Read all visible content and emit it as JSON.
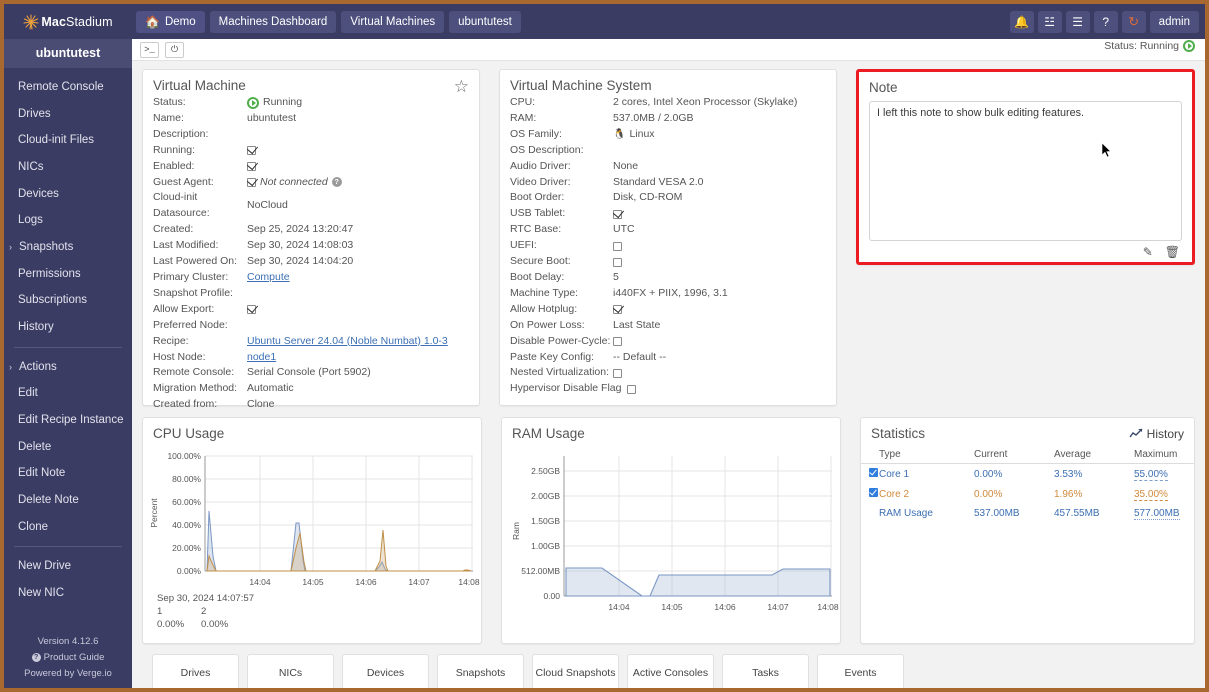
{
  "brand": {
    "name_bold": "Mac",
    "name_rest": "Stadium",
    "logo_icon": "sunburst-logo"
  },
  "topnav": {
    "breadcrumbs": [
      {
        "label": "Demo",
        "icon": "home-icon"
      },
      {
        "label": "Machines Dashboard"
      },
      {
        "label": "Virtual Machines"
      },
      {
        "label": "ubuntutest"
      }
    ],
    "actions": [
      {
        "name": "notifications-icon",
        "glyph": "🔔"
      },
      {
        "name": "rss-icon",
        "glyph": "☳"
      },
      {
        "name": "tasks-icon",
        "glyph": "☰"
      },
      {
        "name": "help-icon",
        "glyph": "?"
      },
      {
        "name": "refresh-icon",
        "glyph": "↻"
      }
    ],
    "user_label": "admin"
  },
  "sidebar": {
    "title": "ubuntutest",
    "items": [
      {
        "label": "Remote Console"
      },
      {
        "label": "Drives"
      },
      {
        "label": "Cloud-init Files"
      },
      {
        "label": "NICs"
      },
      {
        "label": "Devices"
      },
      {
        "label": "Logs"
      },
      {
        "label": "Snapshots",
        "expandable": true
      },
      {
        "label": "Permissions"
      },
      {
        "label": "Subscriptions"
      },
      {
        "label": "History"
      },
      {
        "separator": true
      },
      {
        "label": "Actions",
        "expandable": true
      },
      {
        "label": "Edit"
      },
      {
        "label": "Edit Recipe Instance"
      },
      {
        "label": "Delete"
      },
      {
        "label": "Edit Note"
      },
      {
        "label": "Delete Note"
      },
      {
        "label": "Clone"
      },
      {
        "separator": true
      },
      {
        "label": "New Drive"
      },
      {
        "label": "New NIC"
      }
    ],
    "footer": {
      "version": "Version 4.12.6",
      "product_guide": "Product Guide",
      "powered_by": "Powered by Verge.io"
    }
  },
  "toolbar": {
    "console_icon": ">_",
    "power_icon": "⏻",
    "status_label": "Status: Running"
  },
  "vm_card": {
    "title": "Virtual Machine",
    "favorite_icon": "star-icon",
    "rows": [
      {
        "key": "Status:",
        "value": "Running",
        "type": "status"
      },
      {
        "key": "Name:",
        "value": "ubuntutest"
      },
      {
        "key": "Description:",
        "value": ""
      },
      {
        "key": "Running:",
        "value": "",
        "type": "check"
      },
      {
        "key": "Enabled:",
        "value": "",
        "type": "check"
      },
      {
        "key": "Guest Agent:",
        "value": "Not connected",
        "type": "check-note"
      },
      {
        "key": "Cloud-init Datasource:",
        "value": "NoCloud"
      },
      {
        "key": "Created:",
        "value": "Sep 25, 2024 13:20:47"
      },
      {
        "key": "Last Modified:",
        "value": "Sep 30, 2024 14:08:03"
      },
      {
        "key": "Last Powered On:",
        "value": "Sep 30, 2024 14:04:20"
      },
      {
        "key": "Primary Cluster:",
        "value": "Compute",
        "type": "link"
      },
      {
        "key": "Snapshot Profile:",
        "value": ""
      },
      {
        "key": "Allow Export:",
        "value": "",
        "type": "check"
      },
      {
        "key": "Preferred Node:",
        "value": ""
      },
      {
        "key": "Recipe:",
        "value": "Ubuntu Server 24.04 (Noble Numbat) 1.0-3",
        "type": "link"
      },
      {
        "key": "Host Node:",
        "value": "node1",
        "type": "link"
      },
      {
        "key": "Remote Console:",
        "value": "Serial Console (Port 5902)"
      },
      {
        "key": "Migration Method:",
        "value": "Automatic"
      },
      {
        "key": "Created from:",
        "value": "Clone"
      }
    ]
  },
  "vms_card": {
    "title": "Virtual Machine System",
    "rows": [
      {
        "key": "CPU:",
        "value": "2 cores, Intel Xeon Processor (Skylake)"
      },
      {
        "key": "RAM:",
        "value": "537.0MB / 2.0GB"
      },
      {
        "key": "OS Family:",
        "value": "Linux",
        "type": "os"
      },
      {
        "key": "OS Description:",
        "value": ""
      },
      {
        "key": "Audio Driver:",
        "value": "None"
      },
      {
        "key": "Video Driver:",
        "value": "Standard VESA 2.0"
      },
      {
        "key": "Boot Order:",
        "value": "Disk, CD-ROM"
      },
      {
        "key": "USB Tablet:",
        "value": "",
        "type": "check"
      },
      {
        "key": "RTC Base:",
        "value": "UTC"
      },
      {
        "key": "UEFI:",
        "value": "",
        "type": "uncheck"
      },
      {
        "key": "Secure Boot:",
        "value": "",
        "type": "uncheck"
      },
      {
        "key": "Boot Delay:",
        "value": "5"
      },
      {
        "key": "Machine Type:",
        "value": "i440FX + PIIX, 1996, 3.1"
      },
      {
        "key": "Allow Hotplug:",
        "value": "",
        "type": "check"
      },
      {
        "key": "On Power Loss:",
        "value": "Last State"
      },
      {
        "key": "Disable Power-Cycle:",
        "value": "",
        "type": "uncheck"
      },
      {
        "key": "Paste Key Config:",
        "value": "-- Default --"
      },
      {
        "key": "Nested Virtualization:",
        "value": "",
        "type": "uncheck"
      },
      {
        "key": "Hypervisor Disable Flag",
        "value": "",
        "type": "uncheck"
      }
    ]
  },
  "note_card": {
    "title": "Note",
    "text": "I left this note to show bulk editing features.",
    "edit_icon": "edit-note-icon",
    "delete_icon": "trash-icon",
    "border_color": "#ec1c24"
  },
  "stats_card": {
    "title": "Statistics",
    "history_label": "History",
    "history_icon": "chart-line-icon",
    "columns": [
      "Type",
      "Current",
      "Average",
      "Maximum"
    ],
    "rows": [
      {
        "checkbox": true,
        "type": "Core 1",
        "current": "0.00%",
        "average": "3.53%",
        "maximum": "55.00%",
        "color": "#3c6fb3"
      },
      {
        "checkbox": true,
        "type": "Core 2",
        "current": "0.00%",
        "average": "1.96%",
        "maximum": "35.00%",
        "color": "#d08a3c"
      },
      {
        "checkbox": false,
        "type": "RAM Usage",
        "current": "537.00MB",
        "average": "457.55MB",
        "maximum": "577.00MB",
        "color": "#3c6fb3"
      }
    ]
  },
  "bottom_tabs": [
    {
      "label": "Drives"
    },
    {
      "label": "NICs"
    },
    {
      "label": "Devices"
    },
    {
      "label": "Snapshots"
    },
    {
      "label": "Cloud Snapshots"
    },
    {
      "label": "Active Consoles"
    },
    {
      "label": "Tasks"
    },
    {
      "label": "Events"
    }
  ],
  "chart_data": [
    {
      "type": "area",
      "title": "CPU Usage",
      "xlabel": "",
      "ylabel": "Percent",
      "ylim": [
        0,
        100
      ],
      "yticks": [
        "0.00%",
        "20.00%",
        "40.00%",
        "60.00%",
        "80.00%",
        "100.00%"
      ],
      "xticks": [
        "14:04",
        "14:05",
        "14:06",
        "14:07",
        "14:08"
      ],
      "grid": true,
      "legend": [
        "1",
        "2"
      ],
      "footer_timestamp": "Sep 30, 2024 14:07:57",
      "footer_series": [
        {
          "name": "1",
          "value": "0.00%"
        },
        {
          "name": "2",
          "value": "0.00%"
        }
      ],
      "series": [
        {
          "name": "1",
          "color": "#8ea9d0",
          "x": [
            0,
            1,
            2,
            3,
            4,
            22,
            24,
            26,
            27,
            28,
            50,
            58,
            60,
            62,
            64,
            100
          ],
          "values": [
            0,
            52,
            13,
            0,
            0,
            0,
            41,
            41,
            10,
            0,
            0,
            0,
            4,
            10,
            2,
            0
          ]
        },
        {
          "name": "2",
          "color": "#d2a163",
          "x": [
            0,
            1,
            2,
            3,
            4,
            22,
            24,
            26,
            27,
            28,
            50,
            58,
            60,
            62,
            64,
            100
          ],
          "values": [
            0,
            13,
            5,
            0,
            0,
            0,
            20,
            33,
            8,
            0,
            0,
            0,
            8,
            36,
            4,
            1
          ]
        }
      ]
    },
    {
      "type": "area",
      "title": "RAM Usage",
      "xlabel": "",
      "ylabel": "Ram",
      "ylim": [
        0,
        2684354560
      ],
      "yticks": [
        "0.00",
        "512.00MB",
        "1.00GB",
        "1.50GB",
        "2.00GB",
        "2.50GB"
      ],
      "xticks": [
        "14:04",
        "14:05",
        "14:06",
        "14:07",
        "14:08"
      ],
      "grid": true,
      "series": [
        {
          "name": "Ram",
          "color": "#7f9dc9",
          "x": [
            0,
            14,
            22,
            28,
            30,
            36,
            62,
            66,
            100
          ],
          "values_mb": [
            577,
            577,
            300,
            0,
            0,
            460,
            460,
            570,
            570
          ]
        }
      ]
    }
  ]
}
